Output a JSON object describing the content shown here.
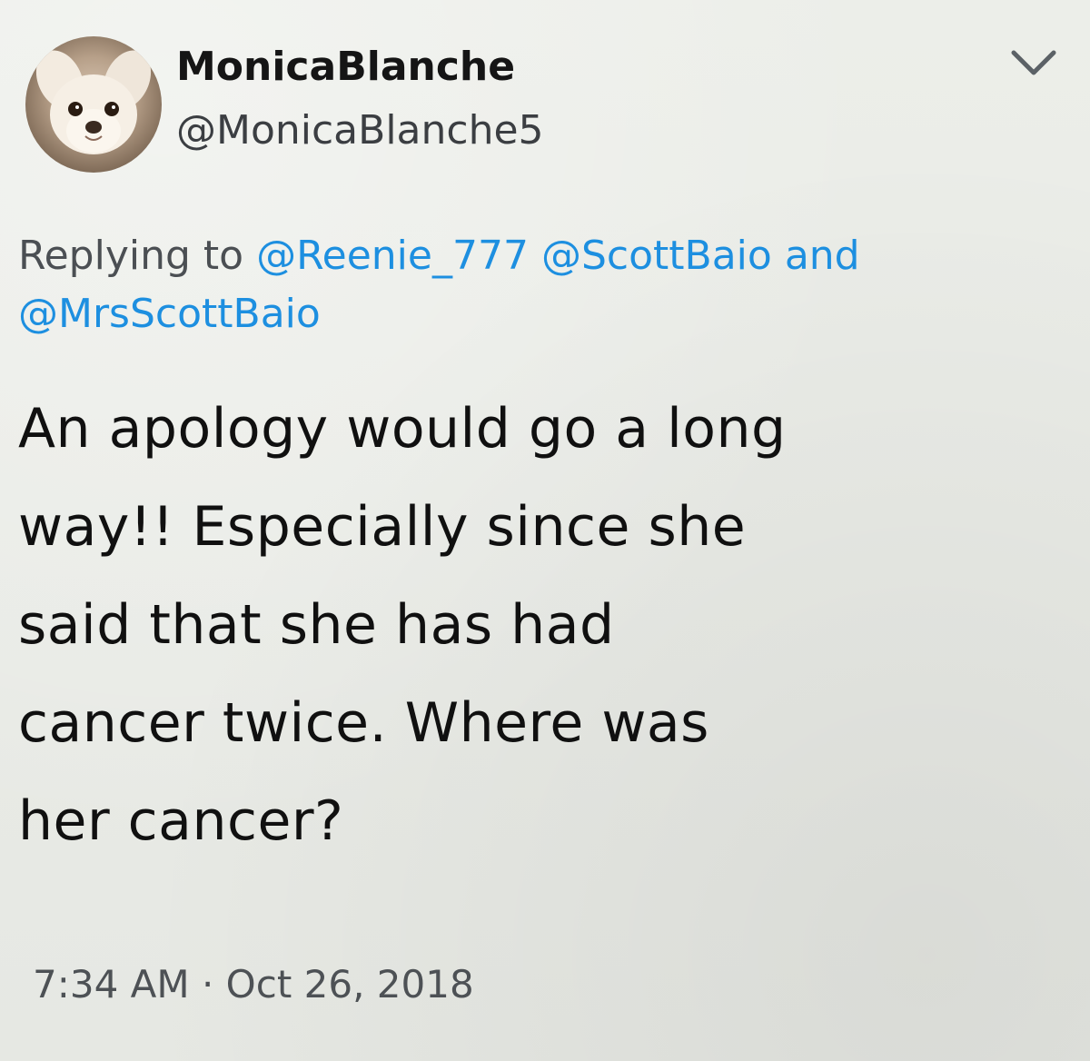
{
  "tweet": {
    "display_name": "MonicaBlanche",
    "handle": "@MonicaBlanche5",
    "reply_prefix": "Replying to",
    "reply_mentions": [
      "@Reenie_777",
      "@ScottBaio",
      "@MrsScottBaio"
    ],
    "reply_and": "and",
    "text_lines": [
      "An apology would go a long",
      "way!! Especially since she",
      "said that she has had",
      "cancer twice. Where was",
      "her cancer?"
    ],
    "timestamp": "7:34 AM · Oct 26, 2018"
  },
  "icons": {
    "menu": "chevron-down-icon",
    "avatar": "dog-avatar"
  },
  "colors": {
    "mention": "#1d8fe0",
    "text": "#101010",
    "secondary": "#4b4f53"
  }
}
